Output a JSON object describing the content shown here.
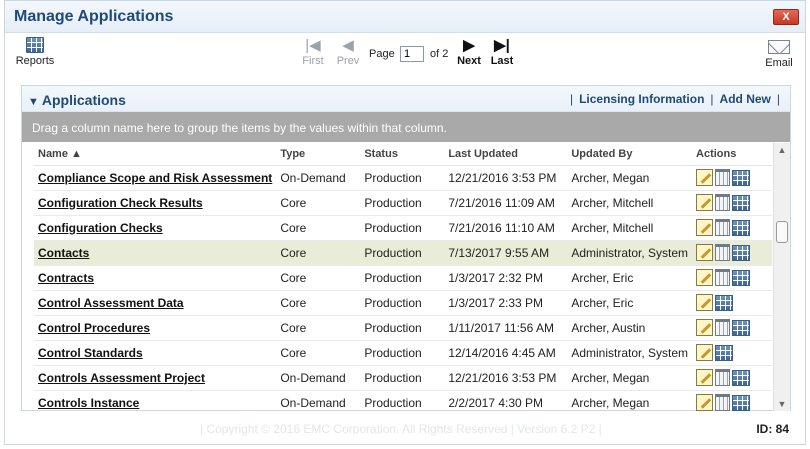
{
  "window": {
    "title": "Manage Applications",
    "close_label": "X"
  },
  "toolbar": {
    "reports_label": "Reports",
    "email_label": "Email",
    "first_label": "First",
    "prev_label": "Prev",
    "next_label": "Next",
    "last_label": "Last",
    "page_label": "Page",
    "page_value": "1",
    "of_label": "of 2"
  },
  "panel": {
    "title": "Applications",
    "licensing_link": "Licensing Information",
    "add_new_link": "Add New",
    "group_hint": "Drag a column name here to group the items by the values within that column."
  },
  "table": {
    "columns": [
      "Name ▲",
      "Type",
      "Status",
      "Last Updated",
      "Updated By",
      "Actions"
    ],
    "rows": [
      {
        "name": "Compliance Scope and Risk Assessment",
        "type": "On-Demand",
        "status": "Production",
        "updated": "12/21/2016 3:53 PM",
        "by": "Archer, Megan"
      },
      {
        "name": "Configuration Check Results",
        "type": "Core",
        "status": "Production",
        "updated": "7/21/2016 11:09 AM",
        "by": "Archer, Mitchell"
      },
      {
        "name": "Configuration Checks",
        "type": "Core",
        "status": "Production",
        "updated": "7/21/2016 11:10 AM",
        "by": "Archer, Mitchell"
      },
      {
        "name": "Contacts",
        "type": "Core",
        "status": "Production",
        "updated": "7/13/2017 9:55 AM",
        "by": "Administrator, System"
      },
      {
        "name": "Contracts",
        "type": "Core",
        "status": "Production",
        "updated": "1/3/2017 2:32 PM",
        "by": "Archer, Eric"
      },
      {
        "name": "Control Assessment Data",
        "type": "Core",
        "status": "Production",
        "updated": "1/3/2017 2:33 PM",
        "by": "Archer, Eric"
      },
      {
        "name": "Control Procedures",
        "type": "Core",
        "status": "Production",
        "updated": "1/11/2017 11:56 AM",
        "by": "Archer, Austin"
      },
      {
        "name": "Control Standards",
        "type": "Core",
        "status": "Production",
        "updated": "12/14/2016 4:45 AM",
        "by": "Administrator, System"
      },
      {
        "name": "Controls Assessment Project",
        "type": "On-Demand",
        "status": "Production",
        "updated": "12/21/2016 3:53 PM",
        "by": "Archer, Megan"
      },
      {
        "name": "Controls Instance",
        "type": "On-Demand",
        "status": "Production",
        "updated": "2/2/2017 4:30 PM",
        "by": "Archer, Megan"
      }
    ]
  },
  "footer": {
    "copyright": "|  Copyright © 2016 EMC Corporation.  All Rights Reserved  |  Version 6.2 P2  |",
    "id_label": "ID: 84"
  }
}
